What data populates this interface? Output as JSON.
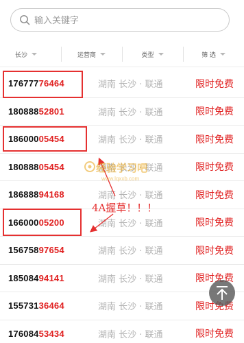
{
  "search": {
    "placeholder": "输入关键字",
    "icon": "search-icon"
  },
  "filters": [
    {
      "label": "长沙"
    },
    {
      "label": "运营商"
    },
    {
      "label": "类型"
    },
    {
      "label": "筛 选"
    }
  ],
  "rows": [
    {
      "prefix": "176777",
      "tail": "76464",
      "location": "湖南 长沙 · 联通",
      "price": "限时免费"
    },
    {
      "prefix": "180888",
      "tail": "52801",
      "location": "湖南 长沙 · 联通",
      "price": "限时免费"
    },
    {
      "prefix": "186000",
      "tail": "05454",
      "location": "湖南 长沙 · 联通",
      "price": "限时免费"
    },
    {
      "prefix": "180888",
      "tail": "05454",
      "location": "湖南 长沙 · 联通",
      "price": "限时免费"
    },
    {
      "prefix": "186888",
      "tail": "94168",
      "location": "湖南 长沙 · 联通",
      "price": "限时免费"
    },
    {
      "prefix": "166000",
      "tail": "05200",
      "location": "湖南 长沙 · 联通",
      "price": "限时免费"
    },
    {
      "prefix": "156758",
      "tail": "97654",
      "location": "湖南 长沙 · 联通",
      "price": "限时免费"
    },
    {
      "prefix": "185084",
      "tail": "94141",
      "location": "湖南 长沙 · 联通",
      "price": "限时免费"
    },
    {
      "prefix": "155731",
      "tail": "36464",
      "location": "湖南 长沙 · 联通",
      "price": "限时免费"
    },
    {
      "prefix": "176084",
      "tail": "53434",
      "location": "湖南 长沙 · 联通",
      "price": "限时免费"
    }
  ],
  "annotation": "4A握草！！！",
  "watermark": {
    "title": "经验学习吧",
    "url": "www.lqxxb.com"
  },
  "fab_icon": "arrow-up-to-top-icon",
  "colors": {
    "accent": "#e02020",
    "location_gray": "#b3b3b3",
    "highlight": "#e53030"
  }
}
